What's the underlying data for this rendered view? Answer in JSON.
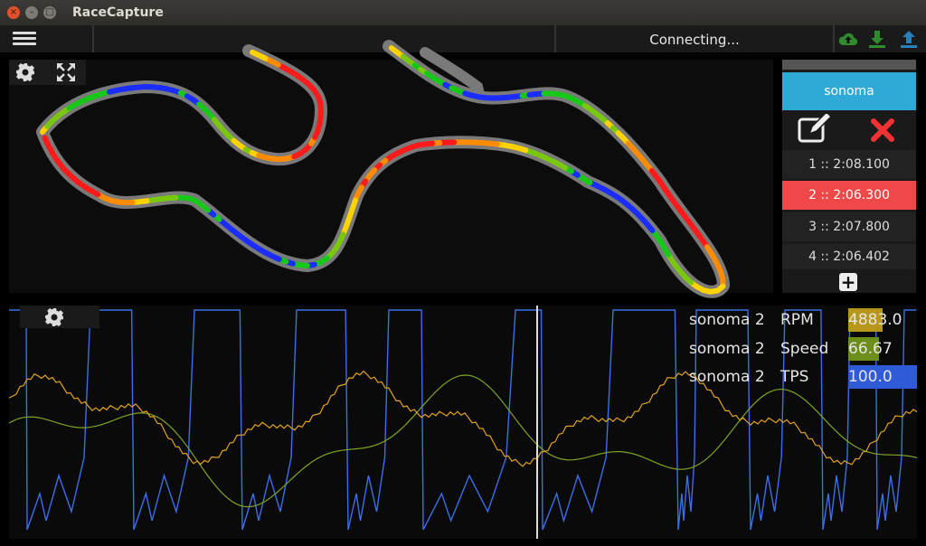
{
  "window": {
    "title": "RaceCapture",
    "buttons": [
      "close",
      "minimize",
      "maximize"
    ]
  },
  "toolbar": {
    "menu_icon": "hamburger-menu-icon",
    "status": "Connecting...",
    "icons": [
      "cloud-upload-icon",
      "download-icon",
      "upload-icon"
    ],
    "icon_colors": {
      "cloud": "#2e8b2e",
      "download": "#2e8b2e",
      "upload": "#2a7fb8"
    }
  },
  "map_panel": {
    "settings_icon": "gear-icon",
    "fullscreen_icon": "expand-icon",
    "speed_colors": [
      "#ff1a1a",
      "#ff8c00",
      "#ffd200",
      "#7ac80e",
      "#18c818",
      "#1a2cff"
    ]
  },
  "sidebar": {
    "track_name": "sonoma",
    "edit_icon": "edit-icon",
    "delete_icon": "close-icon",
    "laps": [
      {
        "label": "1 :: 2:08.100",
        "selected": false
      },
      {
        "label": "2 :: 2:06.300",
        "selected": true
      },
      {
        "label": "3 :: 2:07.800",
        "selected": false
      },
      {
        "label": "4 :: 2:06.402",
        "selected": false
      }
    ],
    "add_label": "+"
  },
  "chart_panel": {
    "settings_icon": "gear-icon",
    "channels": [
      {
        "session": "sonoma  2",
        "channel": "RPM",
        "value": "4883.0",
        "color": "#b7961b",
        "fill": 0.5
      },
      {
        "session": "sonoma  2",
        "channel": "Speed",
        "value": "66.67",
        "color": "#6d8e1a",
        "fill": 0.45
      },
      {
        "session": "sonoma  2",
        "channel": "TPS",
        "value": "100.0",
        "color": "#2f5bd8",
        "fill": 1.0
      }
    ]
  }
}
